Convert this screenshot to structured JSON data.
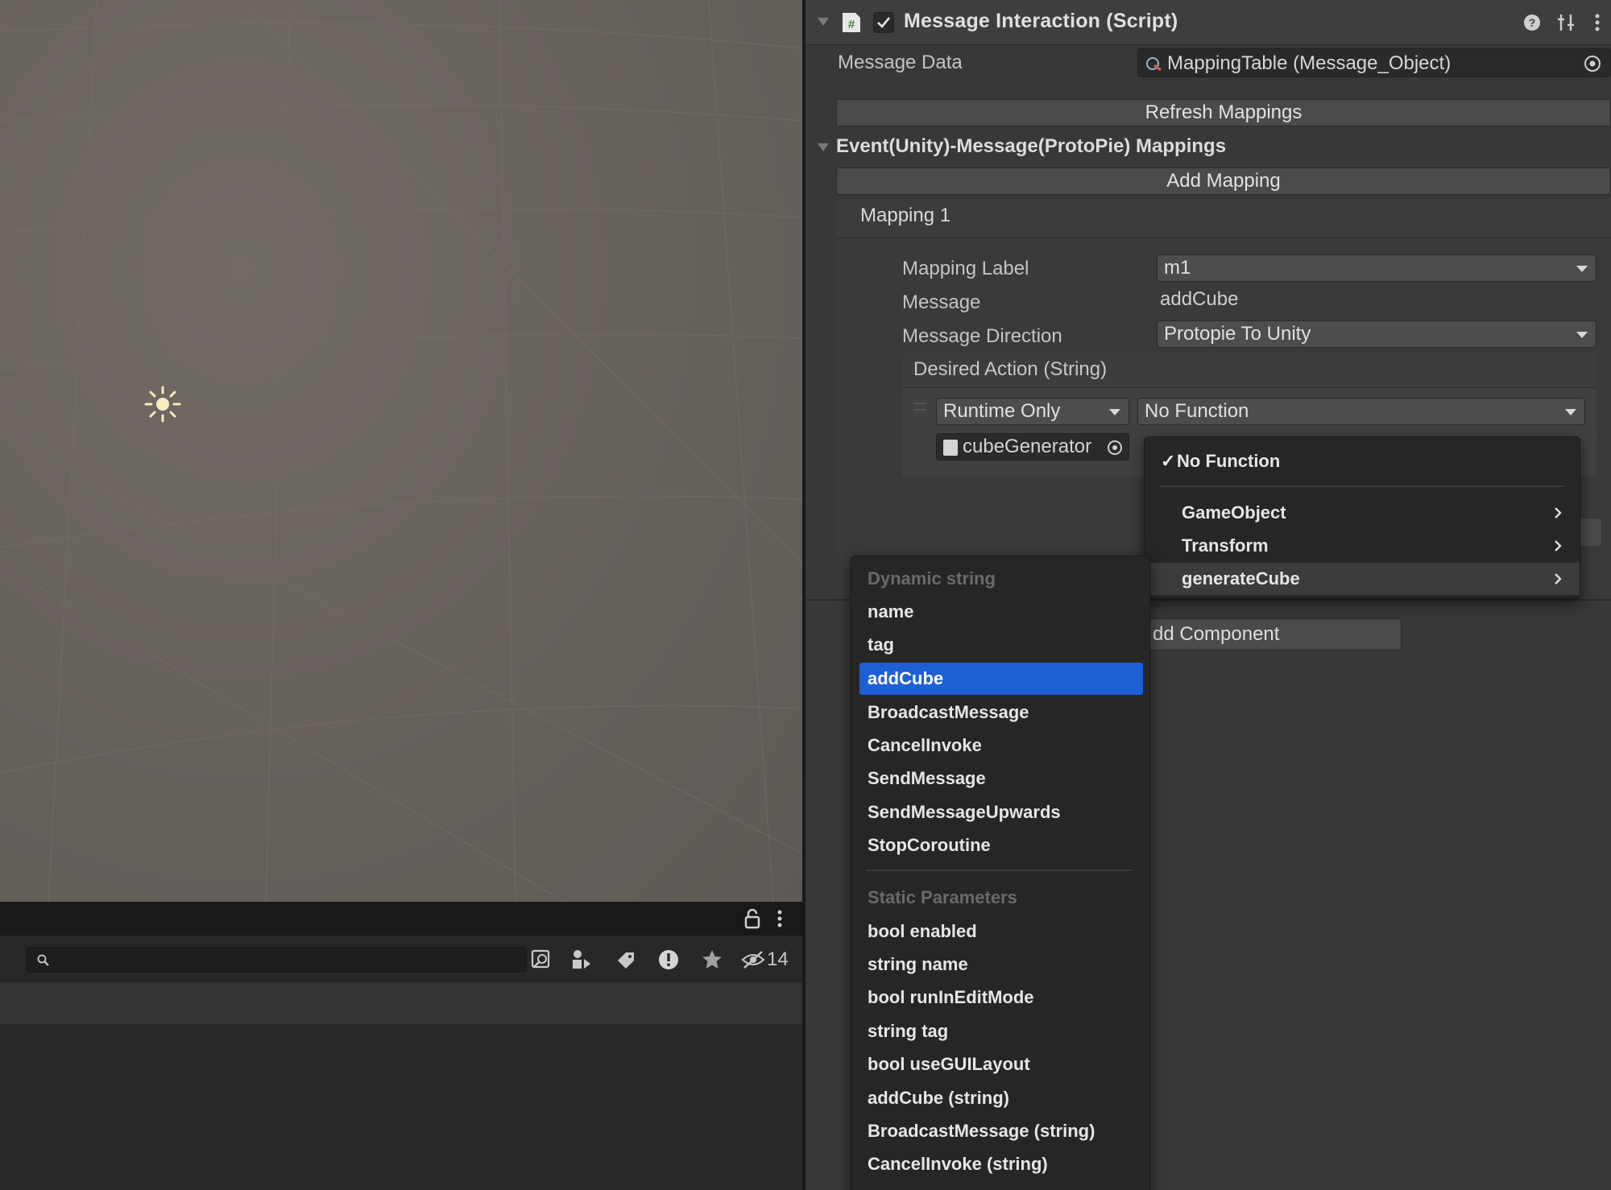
{
  "inspector": {
    "component_title": "Message Interaction (Script)",
    "message_data_label": "Message Data",
    "message_data_value": "MappingTable (Message_Object)",
    "refresh_button": "Refresh Mappings",
    "mappings_section_title": "Event(Unity)-Message(ProtoPie) Mappings",
    "add_mapping_button": "Add Mapping",
    "mapping": {
      "title": "Mapping 1",
      "label_label": "Mapping Label",
      "label_value": "m1",
      "message_label": "Message",
      "message_value": "addCube",
      "direction_label": "Message Direction",
      "direction_value": "Protopie To Unity",
      "desired_action_label": "Desired Action (String)",
      "runtime_value": "Runtime Only",
      "function_value": "No Function",
      "target_object": "cubeGenerator"
    },
    "add_component_button": "dd Component"
  },
  "function_menu": {
    "checked_item": "No Function",
    "items": [
      "GameObject",
      "Transform",
      "generateCube"
    ]
  },
  "method_menu": {
    "dynamic_header": "Dynamic string",
    "dynamic_items": [
      "name",
      "tag",
      "addCube",
      "BroadcastMessage",
      "CancelInvoke",
      "SendMessage",
      "SendMessageUpwards",
      "StopCoroutine"
    ],
    "selected_item": "addCube",
    "static_header": "Static Parameters",
    "static_items": [
      "bool enabled",
      "string name",
      "bool runInEditMode",
      "string tag",
      "bool useGUILayout",
      "addCube (string)",
      "BroadcastMessage (string)",
      "CancelInvoke (string)"
    ]
  },
  "project_toolbar": {
    "hidden_count": "14"
  },
  "colors": {
    "selection": "#1f5fd6",
    "scene_bg": "#68615c",
    "panel_bg": "#383838",
    "menu_bg": "#262626"
  }
}
